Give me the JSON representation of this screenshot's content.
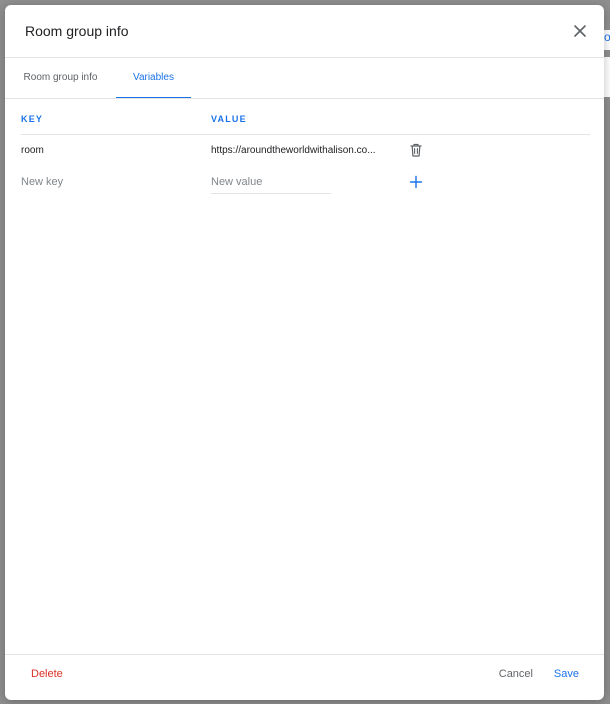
{
  "backdrop": {
    "accent_text": "o"
  },
  "dialog": {
    "title": "Room group info",
    "close_icon": "close-icon"
  },
  "tabs": [
    {
      "label": "Room group info",
      "active": false
    },
    {
      "label": "Variables",
      "active": true
    }
  ],
  "variables": {
    "columns": {
      "key": "KEY",
      "value": "VALUE"
    },
    "rows": [
      {
        "key": "room",
        "value": "https://aroundtheworldwithalison.co...",
        "delete_icon": "trash-icon"
      }
    ],
    "new_row": {
      "key_placeholder": "New key",
      "value_placeholder": "New value",
      "add_icon": "plus-icon"
    }
  },
  "footer": {
    "delete_label": "Delete",
    "cancel_label": "Cancel",
    "save_label": "Save"
  },
  "colors": {
    "accent": "#1a73e8",
    "danger": "#d93025"
  }
}
